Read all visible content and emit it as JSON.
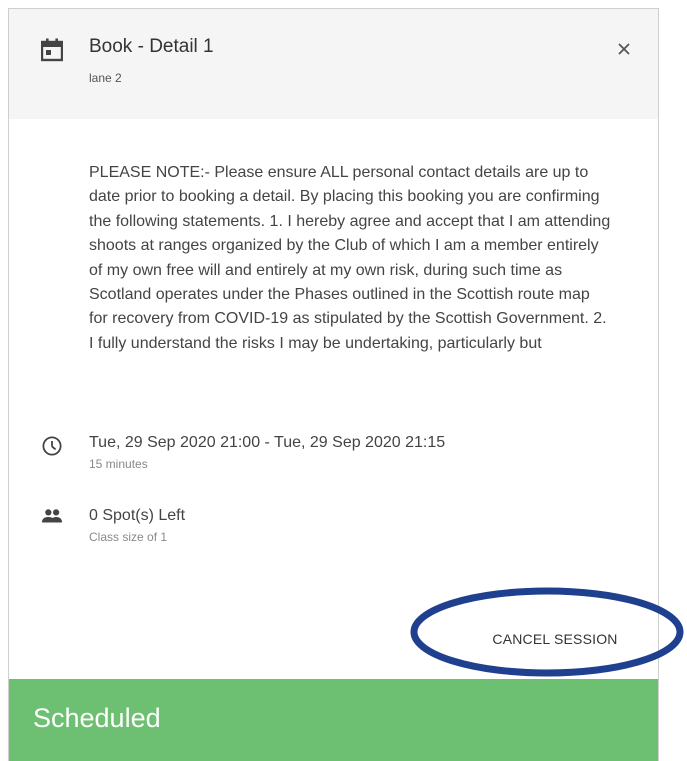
{
  "dialog": {
    "title": "Book - Detail 1",
    "subtitle": "lane 2",
    "icons": {
      "calendar": "calendar-icon",
      "close": "close-icon"
    }
  },
  "notice": {
    "text": "PLEASE NOTE:- Please ensure ALL personal contact details are up to date prior to booking a detail. By placing this booking you are confirming the following statements. 1. I hereby agree and accept that I am attending shoots at ranges organized by the Club of which I am a member entirely of my own free will and entirely at my own risk, during such time as Scotland operates under the Phases outlined in the Scottish route map for recovery from COVID-19 as stipulated by the Scottish Government. 2. I fully understand the risks I may be undertaking, particularly but"
  },
  "session": {
    "time_range": "Tue, 29 Sep 2020 21:00 - Tue, 29 Sep 2020 21:15",
    "duration": "15 minutes",
    "spots_left": "0 Spot(s) Left",
    "class_size": "Class size of 1",
    "icons": {
      "time": "clock-icon",
      "people": "people-icon"
    }
  },
  "actions": {
    "cancel_label": "CANCEL SESSION"
  },
  "status": {
    "label": "Scheduled",
    "color": "#6dbf72"
  },
  "colors": {
    "header_bg": "#f5f5f5",
    "annotation_ellipse": "#1f3f8f"
  }
}
